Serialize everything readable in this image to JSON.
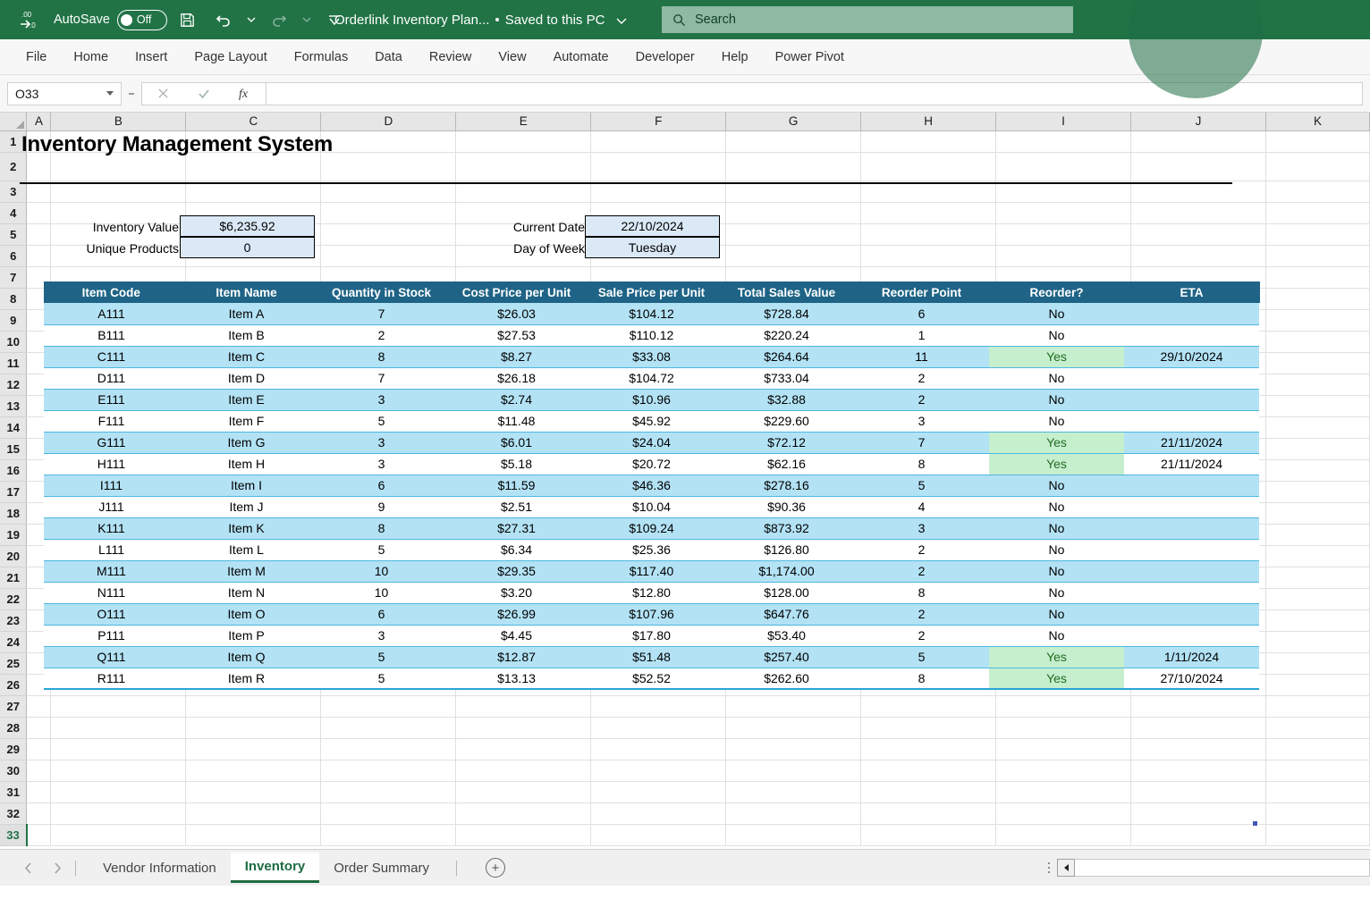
{
  "titlebar": {
    "autosave_label": "AutoSave",
    "autosave_state": "Off",
    "doc_title": "Orderlink Inventory Plan...",
    "doc_status": "Saved to this PC",
    "separator": "•",
    "save_icon": "save-icon",
    "undo_icon": "undo-icon",
    "redo_icon": "redo-icon",
    "customize_icon": "customize-quick-access-icon",
    "search_placeholder": "Search",
    "search_icon": "search-icon"
  },
  "ribbon": {
    "tabs": [
      {
        "label": "File"
      },
      {
        "label": "Home"
      },
      {
        "label": "Insert"
      },
      {
        "label": "Page Layout"
      },
      {
        "label": "Formulas"
      },
      {
        "label": "Data"
      },
      {
        "label": "Review"
      },
      {
        "label": "View"
      },
      {
        "label": "Automate"
      },
      {
        "label": "Developer"
      },
      {
        "label": "Help"
      },
      {
        "label": "Power Pivot"
      }
    ]
  },
  "formulabar": {
    "namebox_value": "O33",
    "cancel_icon": "cancel-icon",
    "enter_icon": "confirm-icon",
    "function_icon": "insert-function-icon",
    "formula_value": ""
  },
  "grid": {
    "columns": [
      "A",
      "B",
      "C",
      "D",
      "E",
      "F",
      "G",
      "H",
      "I",
      "J",
      "K"
    ],
    "rows": [
      1,
      2,
      3,
      4,
      5,
      6,
      7,
      8,
      9,
      10,
      11,
      12,
      13,
      14,
      15,
      16,
      17,
      18,
      19,
      20,
      21,
      22,
      23,
      24,
      25,
      26,
      27,
      28,
      29,
      30,
      31,
      32,
      33
    ],
    "selected_row": 33,
    "selected_cell": "O33"
  },
  "sheet": {
    "title": "Inventory Management System",
    "summary_left": [
      {
        "label": "Inventory Value",
        "value": "$6,235.92"
      },
      {
        "label": "Unique Products",
        "value": "0"
      }
    ],
    "summary_right": [
      {
        "label": "Current Date",
        "value": "22/10/2024"
      },
      {
        "label": "Day of Week",
        "value": "Tuesday"
      }
    ],
    "table": {
      "headers": [
        "Item Code",
        "Item Name",
        "Quantity in Stock",
        "Cost Price per Unit",
        "Sale Price per Unit",
        "Total Sales Value",
        "Reorder Point",
        "Reorder?",
        "ETA"
      ],
      "rows": [
        {
          "code": "A111",
          "name": "Item A",
          "qty": "7",
          "cost": "$26.03",
          "sale": "$104.12",
          "total": "$728.84",
          "reorder_point": "6",
          "reorder": "No",
          "eta": ""
        },
        {
          "code": "B111",
          "name": "Item B",
          "qty": "2",
          "cost": "$27.53",
          "sale": "$110.12",
          "total": "$220.24",
          "reorder_point": "1",
          "reorder": "No",
          "eta": ""
        },
        {
          "code": "C111",
          "name": "Item C",
          "qty": "8",
          "cost": "$8.27",
          "sale": "$33.08",
          "total": "$264.64",
          "reorder_point": "11",
          "reorder": "Yes",
          "eta": "29/10/2024"
        },
        {
          "code": "D111",
          "name": "Item D",
          "qty": "7",
          "cost": "$26.18",
          "sale": "$104.72",
          "total": "$733.04",
          "reorder_point": "2",
          "reorder": "No",
          "eta": ""
        },
        {
          "code": "E111",
          "name": "Item E",
          "qty": "3",
          "cost": "$2.74",
          "sale": "$10.96",
          "total": "$32.88",
          "reorder_point": "2",
          "reorder": "No",
          "eta": ""
        },
        {
          "code": "F111",
          "name": "Item F",
          "qty": "5",
          "cost": "$11.48",
          "sale": "$45.92",
          "total": "$229.60",
          "reorder_point": "3",
          "reorder": "No",
          "eta": ""
        },
        {
          "code": "G111",
          "name": "Item G",
          "qty": "3",
          "cost": "$6.01",
          "sale": "$24.04",
          "total": "$72.12",
          "reorder_point": "7",
          "reorder": "Yes",
          "eta": "21/11/2024"
        },
        {
          "code": "H111",
          "name": "Item H",
          "qty": "3",
          "cost": "$5.18",
          "sale": "$20.72",
          "total": "$62.16",
          "reorder_point": "8",
          "reorder": "Yes",
          "eta": "21/11/2024"
        },
        {
          "code": "I111",
          "name": "Item I",
          "qty": "6",
          "cost": "$11.59",
          "sale": "$46.36",
          "total": "$278.16",
          "reorder_point": "5",
          "reorder": "No",
          "eta": ""
        },
        {
          "code": "J111",
          "name": "Item J",
          "qty": "9",
          "cost": "$2.51",
          "sale": "$10.04",
          "total": "$90.36",
          "reorder_point": "4",
          "reorder": "No",
          "eta": ""
        },
        {
          "code": "K111",
          "name": "Item K",
          "qty": "8",
          "cost": "$27.31",
          "sale": "$109.24",
          "total": "$873.92",
          "reorder_point": "3",
          "reorder": "No",
          "eta": ""
        },
        {
          "code": "L111",
          "name": "Item L",
          "qty": "5",
          "cost": "$6.34",
          "sale": "$25.36",
          "total": "$126.80",
          "reorder_point": "2",
          "reorder": "No",
          "eta": ""
        },
        {
          "code": "M111",
          "name": "Item M",
          "qty": "10",
          "cost": "$29.35",
          "sale": "$117.40",
          "total": "$1,174.00",
          "reorder_point": "2",
          "reorder": "No",
          "eta": ""
        },
        {
          "code": "N111",
          "name": "Item N",
          "qty": "10",
          "cost": "$3.20",
          "sale": "$12.80",
          "total": "$128.00",
          "reorder_point": "8",
          "reorder": "No",
          "eta": ""
        },
        {
          "code": "O111",
          "name": "Item O",
          "qty": "6",
          "cost": "$26.99",
          "sale": "$107.96",
          "total": "$647.76",
          "reorder_point": "2",
          "reorder": "No",
          "eta": ""
        },
        {
          "code": "P111",
          "name": "Item P",
          "qty": "3",
          "cost": "$4.45",
          "sale": "$17.80",
          "total": "$53.40",
          "reorder_point": "2",
          "reorder": "No",
          "eta": ""
        },
        {
          "code": "Q111",
          "name": "Item Q",
          "qty": "5",
          "cost": "$12.87",
          "sale": "$51.48",
          "total": "$257.40",
          "reorder_point": "5",
          "reorder": "Yes",
          "eta": "1/11/2024"
        },
        {
          "code": "R111",
          "name": "Item R",
          "qty": "5",
          "cost": "$13.13",
          "sale": "$52.52",
          "total": "$262.60",
          "reorder_point": "8",
          "reorder": "Yes",
          "eta": "27/10/2024"
        }
      ]
    }
  },
  "sheetbar": {
    "prev_icon": "previous-sheet-icon",
    "next_icon": "next-sheet-icon",
    "tabs": [
      {
        "label": "Vendor Information",
        "active": false
      },
      {
        "label": "Inventory",
        "active": true
      },
      {
        "label": "Order Summary",
        "active": false
      }
    ],
    "add_label": "+",
    "scroll_left_icon": "scroll-left-icon"
  },
  "colors": {
    "brand_green": "#217346",
    "table_header": "#1f6486",
    "band_blue": "#b3e2f5",
    "yes_fill": "#c6efce",
    "input_fill": "#dbe9f7"
  }
}
